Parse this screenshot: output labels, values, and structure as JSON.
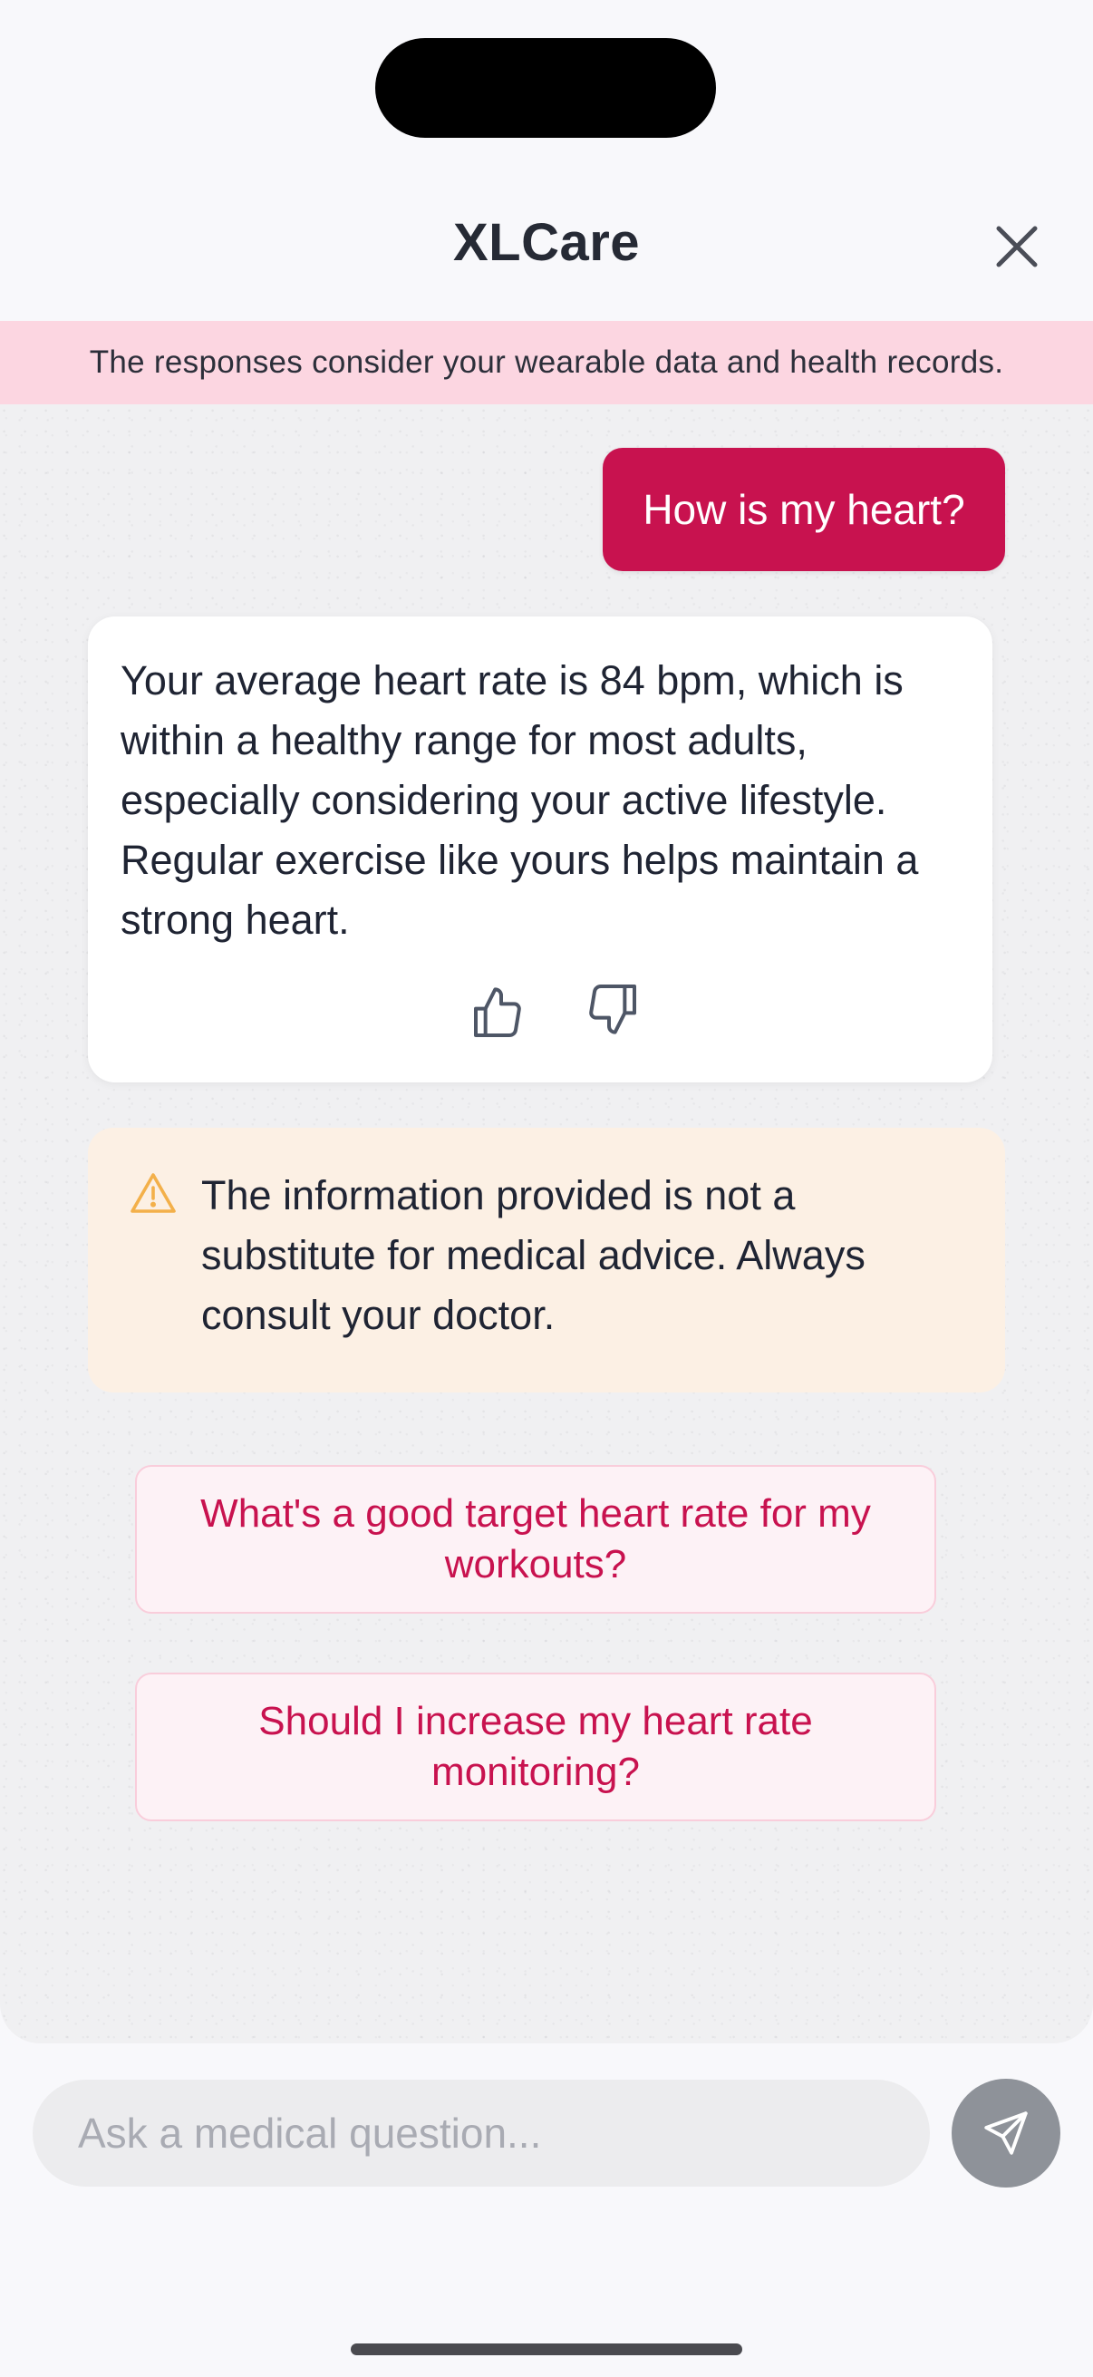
{
  "header": {
    "title": "XLCare",
    "close_icon": "close-icon"
  },
  "banner": {
    "text": "The responses consider your wearable data and health records."
  },
  "messages": {
    "user": "How is my heart?",
    "assistant": "Your average heart rate is 84 bpm, which is within a healthy range for most adults, especially considering your active lifestyle. Regular exercise like yours helps maintain a strong heart.",
    "feedback_icons": [
      "thumbs-up-icon",
      "thumbs-down-icon"
    ]
  },
  "disclaimer": {
    "icon": "warning-icon",
    "text": "The information provided is not a substitute for medical advice. Always consult your doctor.",
    "color": "#f3b04a"
  },
  "suggestions": [
    "What's a good target heart rate for my workouts?",
    "Should I increase my heart rate monitoring?"
  ],
  "composer": {
    "placeholder": "Ask a medical question...",
    "send_icon": "send-icon"
  },
  "colors": {
    "accent": "#c8124f",
    "banner_bg": "#fcd6e1",
    "disclaimer_bg": "#fcf0e4",
    "suggestion_bg": "#fdf2f6",
    "send_button": "#8e9299"
  }
}
